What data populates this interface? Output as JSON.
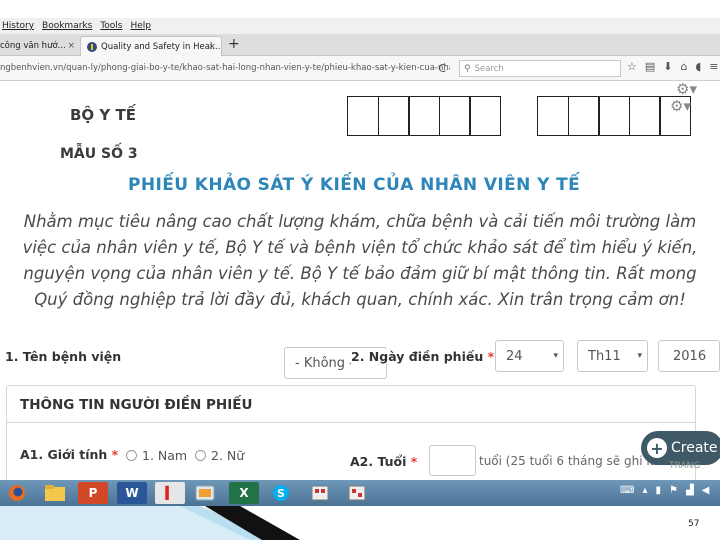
{
  "browser": {
    "menu": [
      "History",
      "Bookmarks",
      "Tools",
      "Help"
    ],
    "tabs": [
      {
        "label": "công văn hướ...",
        "close": "×"
      },
      {
        "label": "Quality and Safety in Heal...",
        "close": "×"
      }
    ],
    "new_tab": "+",
    "url": "ngbenhvien.vn/quan-ly/phong-giai-bo-y-te/khao-sat-hai-long-nhan-vien-y-te/phieu-khao-sat-y-kien-cua-nhan-vien",
    "reload": "C",
    "search_placeholder": "Search"
  },
  "form": {
    "ministry": "BỘ Y TẾ",
    "form_number": "MẪU SỐ 3",
    "title": "PHIẾU KHẢO SÁT Ý KIẾN CỦA NHÂN VIÊN Y TẾ",
    "intro": "Nhằm mục tiêu nâng cao chất lượng khám, chữa bệnh và cải tiến môi trường làm việc của nhân viên y tế, Bộ Y tế và bệnh viện tổ chức khảo sát để tìm hiểu ý kiến, nguyện vọng của nhân viên y tế. Bộ Y tế bảo đảm giữ bí mật thông tin. Rất mong Quý đồng nghiệp trả lời đầy đủ, khách quan, chính xác. Xin trân trọng cảm ơn!",
    "q1_label": "1. Tên bệnh viện",
    "hospital_select": "- Không -",
    "q2_label": "2. Ngày điền phiếu",
    "required_mark": "*",
    "day": "24",
    "month": "Th11",
    "year": "2016",
    "section_title": "THÔNG TIN NGƯỜI ĐIỀN PHIẾU",
    "a1_label": "A1. Giới tính",
    "gender_options": [
      "1. Nam",
      "2. Nữ"
    ],
    "a2_label": "A2. Tuổi",
    "age_note": "tuổi (25 tuổi 6 tháng sẽ ghi là",
    "create_button": "Create",
    "trang_label": "TRANG"
  },
  "taskbar": {
    "apps": [
      "firefox-icon",
      "file-explorer-icon",
      "powerpoint-icon",
      "word-icon",
      "acrobat-icon",
      "system-icon",
      "excel-icon",
      "skype-icon",
      "app-icon",
      "app-icon"
    ]
  },
  "slide": {
    "page_number": "57"
  },
  "colors": {
    "title_blue": "#2d86b8",
    "required_red": "#e23b3b",
    "taskbar_blue": "#5a82a6"
  }
}
